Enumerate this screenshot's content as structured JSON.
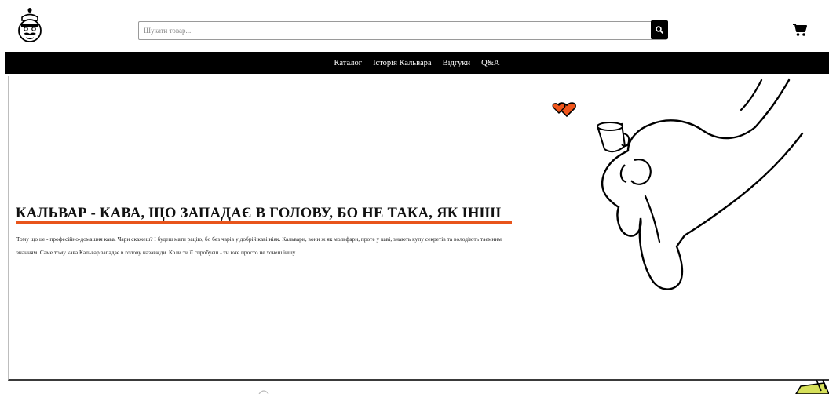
{
  "header": {
    "logo_icon": "mustache-mascot-icon",
    "search": {
      "placeholder": "Шукати товар...",
      "value": "",
      "button_icon": "search-icon"
    },
    "cart_icon": "cart-icon"
  },
  "nav": {
    "items": [
      {
        "label": "Каталог"
      },
      {
        "label": "Історія Кальвара"
      },
      {
        "label": "Відгуки"
      },
      {
        "label": "Q&A"
      }
    ]
  },
  "hero": {
    "title": "КАЛЬВАР - КАВА, ЩО ЗАПАДАЄ В ГОЛОВУ, БО НЕ ТАКА, ЯК ІНШІ",
    "text": "Тому що це - професійно-домашня кава. Чари скажеш? І будеш мати рацію, бо без чарів у добрій каві ніяк. Кальвари, вони ж як мольфари, проте у каві, знають купу секретів та володіють таємним знанням. Саме тому кава Кальвар западає в голову назавжди. Коли ти її спробуєш - ти вже просто не хочеш іншу.",
    "illustration": "hand-holding-coffee-cup-with-hearts",
    "accent_color": "#e8541b"
  },
  "colors": {
    "nav_background": "#000000",
    "accent": "#e8541b",
    "heart": "#f0561c"
  }
}
